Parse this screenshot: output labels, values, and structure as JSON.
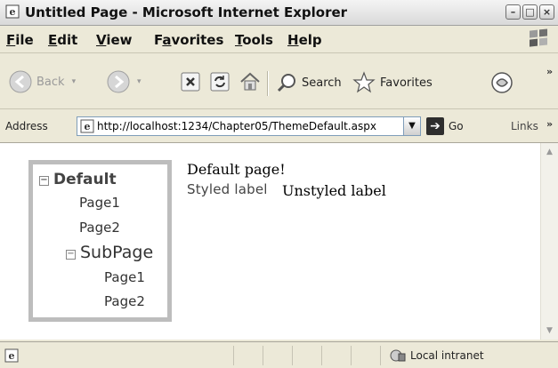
{
  "window": {
    "title": "Untitled Page - Microsoft Internet Explorer"
  },
  "menu": {
    "items": [
      {
        "label": "File",
        "accel": "F",
        "rest": "ile"
      },
      {
        "label": "Edit",
        "accel": "E",
        "rest": "dit"
      },
      {
        "label": "View",
        "accel": "V",
        "rest": "iew"
      },
      {
        "label": "Favorites",
        "pre": "F",
        "accel": "a",
        "rest": "vorites"
      },
      {
        "label": "Tools",
        "accel": "T",
        "rest": "ools"
      },
      {
        "label": "Help",
        "accel": "H",
        "rest": "elp"
      }
    ]
  },
  "toolbar": {
    "back_label": "Back",
    "search_label": "Search",
    "favorites_label": "Favorites"
  },
  "address": {
    "label": "Address",
    "url": "http://localhost:1234/Chapter05/ThemeDefault.aspx",
    "go_label": "Go",
    "links_label": "Links"
  },
  "tree": {
    "root": "Default",
    "page1": "Page1",
    "page2": "Page2",
    "subpage": "SubPage",
    "sub_page1": "Page1",
    "sub_page2": "Page2"
  },
  "content": {
    "heading": "Default page!",
    "styled_label": "Styled label",
    "unstyled_label": "Unstyled label"
  },
  "status": {
    "zone": "Local intranet"
  },
  "icons": {
    "ie": "ie-page-icon",
    "back": "back-arrow-icon",
    "forward": "forward-arrow-icon",
    "stop": "stop-icon",
    "refresh": "refresh-icon",
    "home": "home-icon",
    "search": "search-icon",
    "favorites": "favorites-star-icon",
    "media": "media-icon"
  }
}
